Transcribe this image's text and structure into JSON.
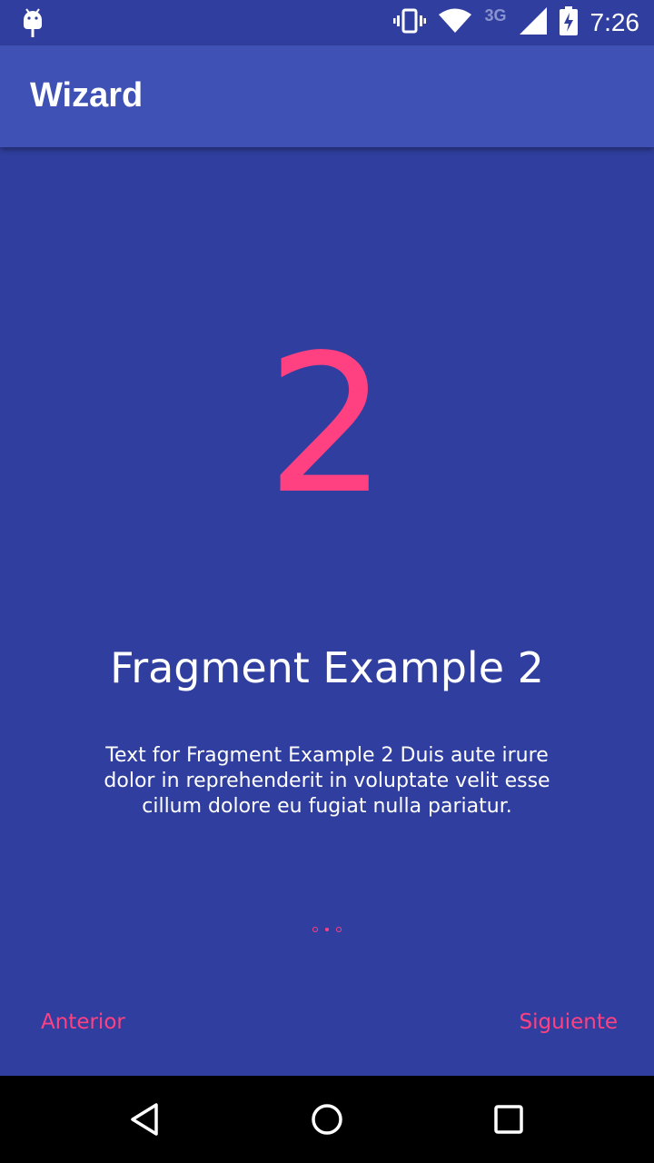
{
  "status_bar": {
    "network_label": "3G",
    "time": "7:26",
    "icons": [
      "android-debug-icon",
      "vibrate-icon",
      "wifi-icon",
      "signal-icon",
      "battery-charging-icon"
    ]
  },
  "app_bar": {
    "title": "Wizard"
  },
  "fragment": {
    "number": "2",
    "title": "Fragment Example 2",
    "text": "Text for Fragment Example 2 Duis aute irure dolor in reprehenderit in voluptate velit esse cillum dolore eu fugiat nulla pariatur."
  },
  "pager": {
    "page_count": 3,
    "current_page": 2
  },
  "navigation": {
    "previous_label": "Anterior",
    "next_label": "Siguiente"
  },
  "colors": {
    "background": "#303F9F",
    "app_bar": "#3F51B5",
    "accent": "#FF4081"
  },
  "system_nav": {
    "icons": [
      "back-icon",
      "home-icon",
      "recents-icon"
    ]
  }
}
